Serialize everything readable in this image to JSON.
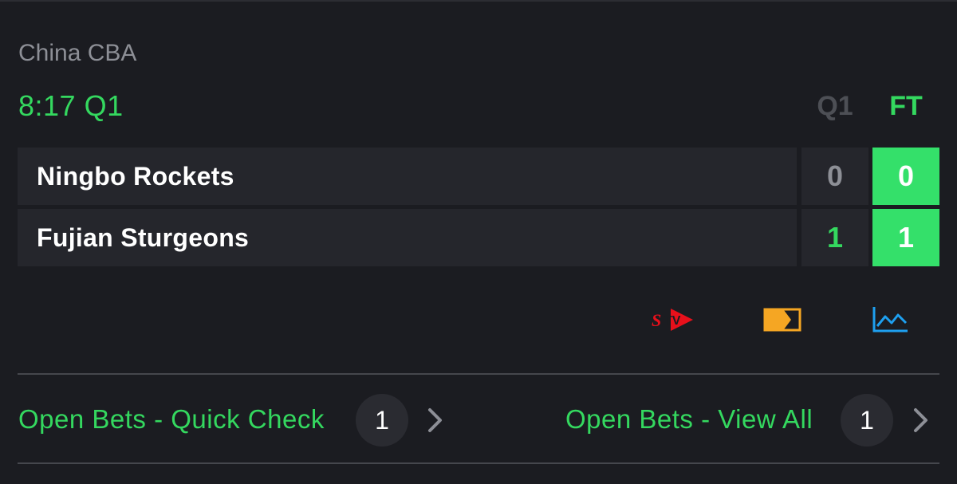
{
  "event": {
    "league": "China CBA",
    "clock": "8:17 Q1"
  },
  "score_columns": {
    "period": "Q1",
    "total": "FT"
  },
  "teams": [
    {
      "name": "Ningbo Rockets",
      "q1": "0",
      "ft": "0"
    },
    {
      "name": "Fujian Sturgeons",
      "q1": "1",
      "ft": "1"
    }
  ],
  "icons": {
    "stream": "stv-icon",
    "field": "match-tracker-icon",
    "stats": "stats-chart-icon"
  },
  "open_bets": {
    "quick_check": {
      "label": "Open Bets - Quick Check",
      "count": "1"
    },
    "view_all": {
      "label": "Open Bets - View All",
      "count": "1"
    }
  },
  "colors": {
    "background": "#1b1c21",
    "cell": "#25262c",
    "accent_green": "#34d85f",
    "ft_cell": "#34e06a",
    "stv_red": "#e8101b",
    "field_orange": "#f5a623",
    "chart_blue": "#1ea0f0"
  }
}
